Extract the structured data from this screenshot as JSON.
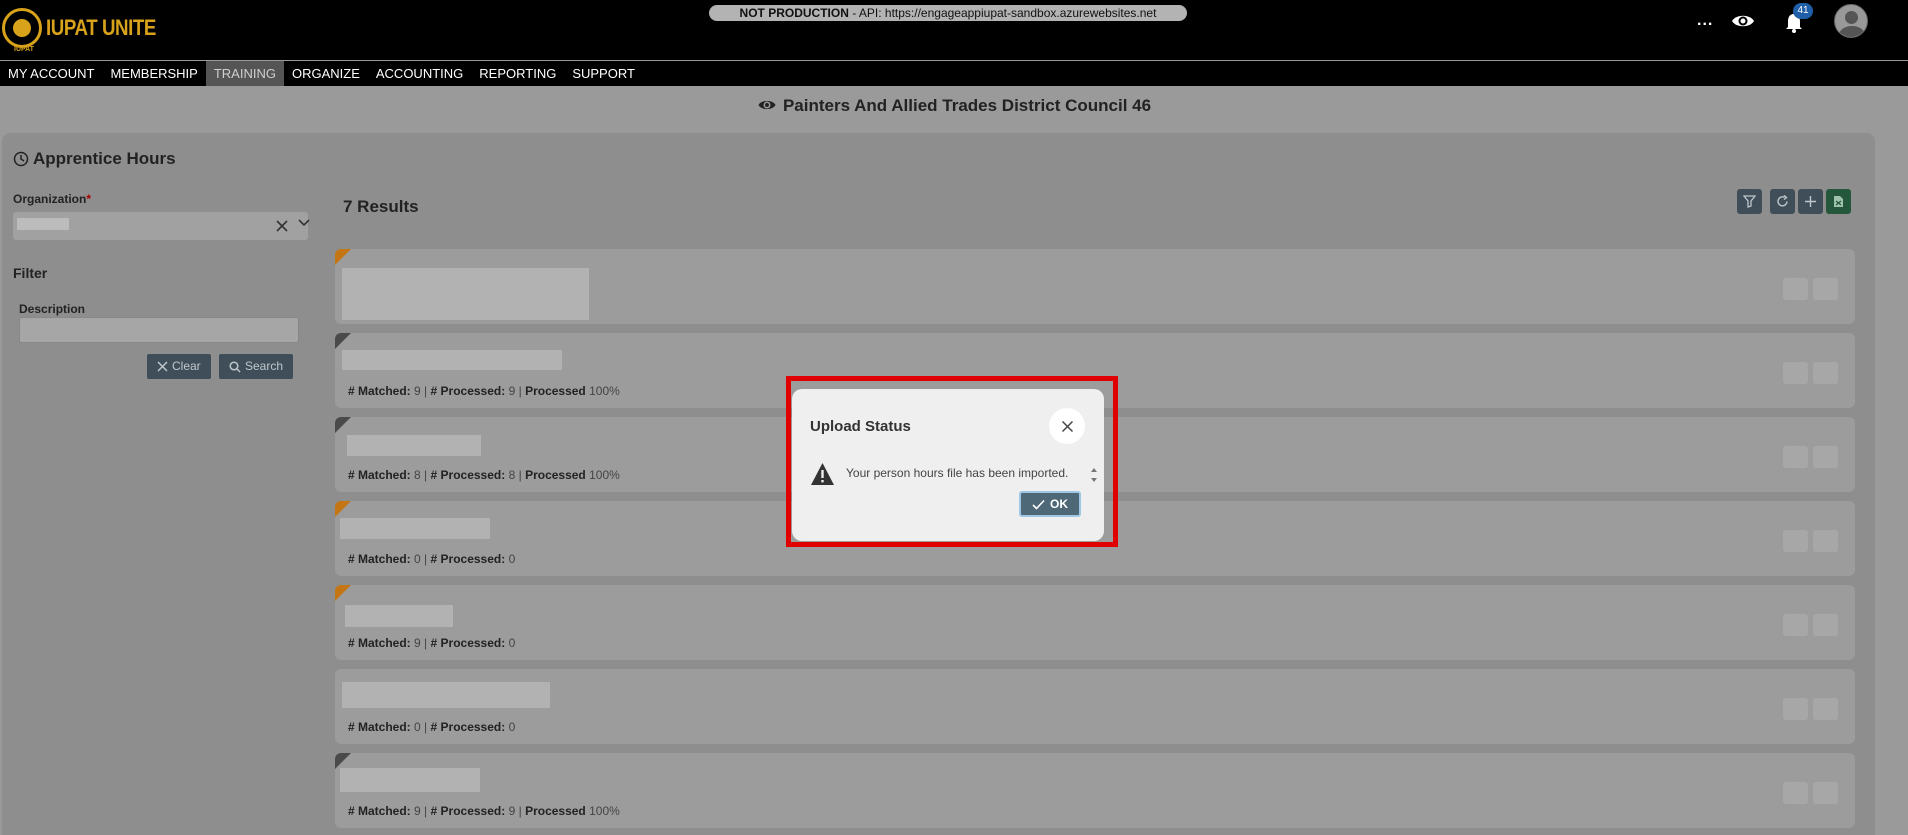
{
  "app": {
    "logo_text": "IUPAT UNITE",
    "logo_sub": "IUPAT",
    "env_label": "NOT PRODUCTION",
    "env_api": " - API: https://engageappiupat-sandbox.azurewebsites.net",
    "more_label": "...",
    "notification_count": "41"
  },
  "nav": {
    "items": [
      "MY ACCOUNT",
      "MEMBERSHIP",
      "TRAINING",
      "ORGANIZE",
      "ACCOUNTING",
      "REPORTING",
      "SUPPORT"
    ],
    "active": "TRAINING"
  },
  "page": {
    "org_title": "Painters And Allied Trades District Council 46",
    "section_title": "Apprentice Hours",
    "organization_label": "Organization",
    "required_mark": "*",
    "filter_title": "Filter",
    "description_label": "Description",
    "description_value": "",
    "clear_label": "Clear",
    "search_label": "Search",
    "results_title": "7 Results"
  },
  "results": [
    {
      "status_color": "orange",
      "meta": null
    },
    {
      "status_color": "gray",
      "matched": "9",
      "processed": "9",
      "percent": "100%"
    },
    {
      "status_color": "gray",
      "matched": "8",
      "processed": "8",
      "percent": "100%"
    },
    {
      "status_color": "orange",
      "matched": "0",
      "processed": "0",
      "percent": null
    },
    {
      "status_color": "orange",
      "matched": "9",
      "processed": "0",
      "percent": null
    },
    {
      "status_color": "none",
      "matched": "0",
      "processed": "0",
      "percent": null
    },
    {
      "status_color": "gray",
      "matched": "9",
      "processed": "9",
      "percent": "100%"
    }
  ],
  "labels": {
    "matched": "# Matched:",
    "processed_count": "# Processed:",
    "processed_pct": "Processed",
    "sep": " | "
  },
  "modal": {
    "title": "Upload Status",
    "message": "Your person hours file has been imported.",
    "ok_label": "OK"
  },
  "colors": {
    "accent_gold": "#d8a21b",
    "highlight_red": "#e00000",
    "ok_button": "#4f6877",
    "export_green": "#24573c"
  }
}
